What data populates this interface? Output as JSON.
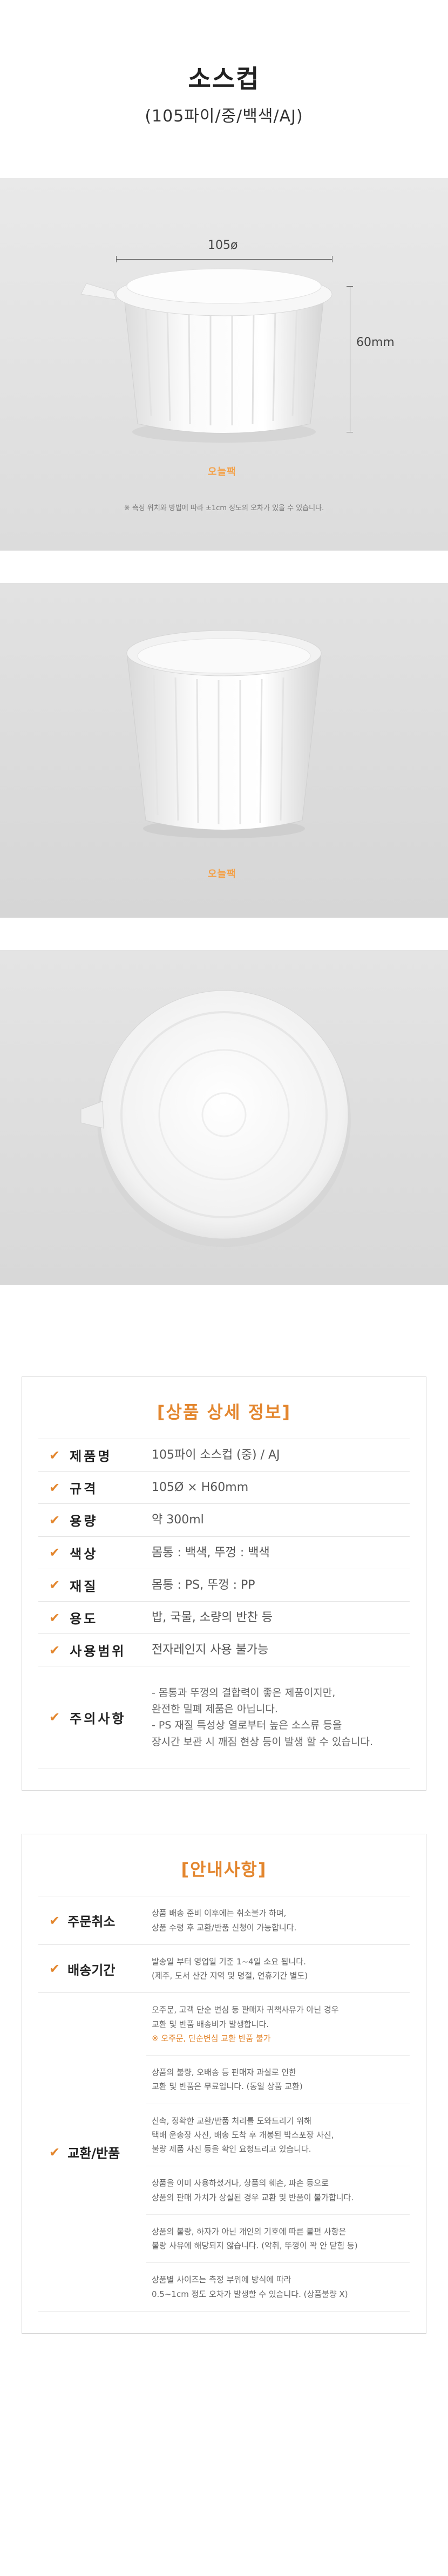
{
  "header": {
    "title": "소스컵",
    "subtitle": "(105파이/중/백색/AJ)"
  },
  "photo1": {
    "width_label": "105ø",
    "height_label": "60mm",
    "note": "※ 측정 위치와 방법에 따라 ±1cm 정도의 오차가 있을 수 있습니다.",
    "logo": "오늘팩"
  },
  "photo2": {
    "logo": "오늘팩"
  },
  "spec": {
    "heading": "[상품 상세 정보]",
    "rows": [
      {
        "label": "제품명",
        "value": "105파이 소스컵 (중) / AJ"
      },
      {
        "label": "규격",
        "value": "105Ø × H60mm"
      },
      {
        "label": "용량",
        "value": "약 300ml"
      },
      {
        "label": "색상",
        "value": "몸통 : 백색, 뚜껑 : 백색"
      },
      {
        "label": "재질",
        "value": "몸통 : PS, 뚜껑 : PP"
      },
      {
        "label": "용도",
        "value": "밥, 국물, 소량의 반찬 등"
      },
      {
        "label": "사용범위",
        "value": "전자레인지 사용 불가능"
      },
      {
        "label": "주의사항",
        "lines": [
          "- 몸통과 뚜껑의 결합력이 좋은 제품이지만,",
          "  완전한 밀폐 제품은 아닙니다.",
          "- PS 재질 특성상 열로부터 높은 소스류 등을",
          "  장시간 보관 시 깨짐 현상 등이 발생 할 수 있습니다."
        ]
      }
    ]
  },
  "notice": {
    "heading": "[안내사항]",
    "rows": [
      {
        "label": "주문취소",
        "items": [
          [
            "상품 배송 준비 이후에는 취소불가 하며,",
            "상품 수령 후 교환/반품 신청이 가능합니다."
          ]
        ]
      },
      {
        "label": "배송기간",
        "items": [
          [
            "발송일 부터 영업일 기준 1~4일 소요 됩니다.",
            "(제주, 도서 산간 지역 및 명절, 연휴기간 별도)"
          ]
        ]
      },
      {
        "label": "교환/반품",
        "items": [
          [
            "오주문, 고객 단순 변심 등 판매자 귀책사유가 아닌 경우",
            "교환 및 반품 배송비가 발생합니다.",
            "※ 오주문, 단순변심 교환 반품 불가"
          ],
          [
            "상품의 불량, 오배송 등 판매자 과실로 인한",
            "교환 및 반품은 무료입니다. (동일 상품 교환)"
          ],
          [
            "신속, 정확한 교환/반품 처리를 도와드리기 위해",
            "택배 운송장 사진, 배송 도착 후 개봉된 박스포장 사진,",
            "불량 제품 사진 등을 확인 요청드리고 있습니다."
          ],
          [
            "상품을 이미 사용하셨거나, 상품의 훼손, 파손 등으로",
            "상품의 판매 가치가 상실된 경우 교환 및 반품이 불가합니다."
          ],
          [
            "상품의 불량, 하자가 아닌 개인의 기호에 따른 불편 사항은",
            "불량 사유에 해당되지 않습니다. (악취, 뚜껑이 꽉 안 닫힘 등)"
          ],
          [
            "상품별 사이즈는 측정 부위에 방식에 따라",
            "0.5~1cm 정도 오차가 발생할 수 있습니다. (상품불량 X)"
          ]
        ]
      }
    ]
  },
  "colors": {
    "accent": "#e3862e",
    "photo_bg": "#e3e3e3"
  }
}
